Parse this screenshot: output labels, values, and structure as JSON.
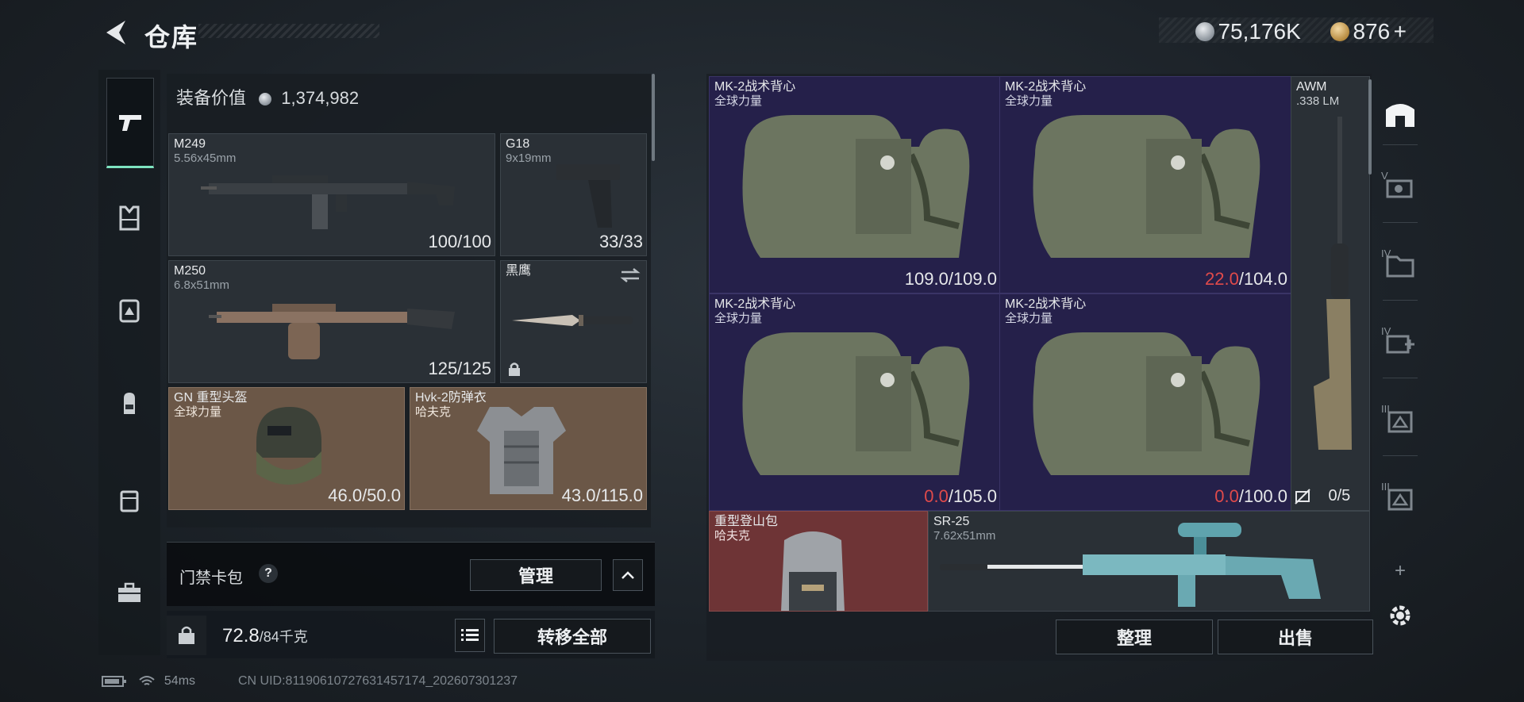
{
  "header": {
    "title": "仓库",
    "currency_silver": "75,176K",
    "currency_gold": "876",
    "add_symbol": "+"
  },
  "left": {
    "value_label": "装备价值",
    "value_amount": "1,374,982",
    "slots": [
      {
        "name": "M249",
        "sub": "5.56x45mm",
        "durability": "100/100"
      },
      {
        "name": "G18",
        "sub": "9x19mm",
        "durability": "33/33"
      },
      {
        "name": "M250",
        "sub": "6.8x51mm",
        "durability": "125/125"
      },
      {
        "name": "黑鹰",
        "sub": "",
        "durability": ""
      },
      {
        "name": "GN 重型头盔",
        "sub": "全球力量",
        "durability": "46.0/50.0"
      },
      {
        "name": "Hvk-2防弹衣",
        "sub": "哈夫克",
        "durability": "43.0/115.0"
      }
    ],
    "keycard_label": "门禁卡包",
    "keycard_help": "?",
    "manage_label": "管理",
    "weight_value": "72.8",
    "weight_max": "/84千克",
    "transfer_all_label": "转移全部"
  },
  "right": {
    "vests": [
      {
        "name": "MK-2战术背心",
        "sub": "全球力量",
        "cur": "109.0",
        "max": "/109.0",
        "low": false
      },
      {
        "name": "MK-2战术背心",
        "sub": "全球力量",
        "cur": "22.0",
        "max": "/104.0",
        "low": true
      },
      {
        "name": "MK-2战术背心",
        "sub": "全球力量",
        "cur": "0.0",
        "max": "/105.0",
        "low": true
      },
      {
        "name": "MK-2战术背心",
        "sub": "全球力量",
        "cur": "0.0",
        "max": "/100.0",
        "low": true
      }
    ],
    "awm": {
      "name": "AWM",
      "sub": ".338 LM",
      "ammo": "0/5"
    },
    "backpack": {
      "name": "重型登山包",
      "sub": "哈夫克"
    },
    "sr25": {
      "name": "SR-25",
      "sub": "7.62x51mm"
    },
    "sort_label": "整理",
    "sell_label": "出售",
    "tier_labels": [
      "V",
      "IV",
      "IV",
      "III",
      "III"
    ],
    "add_symbol": "+"
  },
  "status": {
    "ping": "54ms",
    "uid": "CN UID:8119061072763145717​4_202607301237"
  },
  "colors": {
    "accent_teal": "#7ee3c0",
    "low_durability": "#e04a4a",
    "brown_slot": "#6b5747",
    "red_slot": "#6e3436",
    "grid_bg": "#25204a"
  }
}
